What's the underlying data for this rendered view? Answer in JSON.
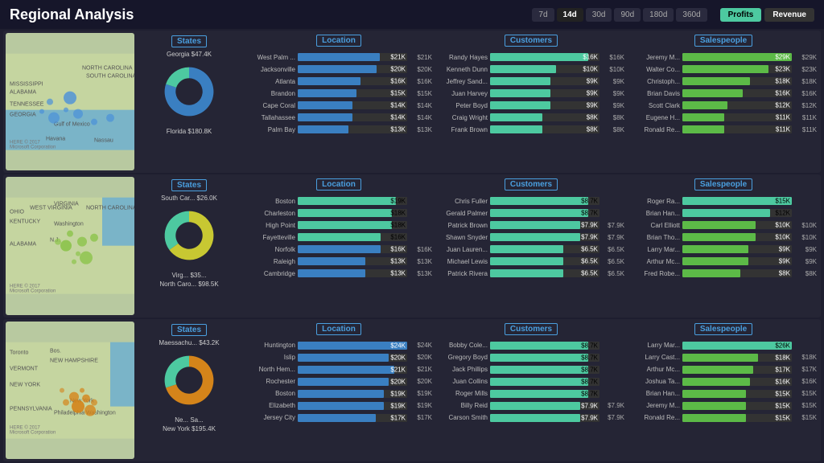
{
  "header": {
    "title": "Regional Analysis",
    "time_buttons": [
      "7d",
      "14d",
      "30d",
      "90d",
      "180d",
      "360d"
    ],
    "active_time": "14d",
    "toggle_profits": "Profits",
    "toggle_revenue": "Revenue"
  },
  "rows": [
    {
      "id": "row1",
      "map_region": "Southeast US",
      "states_header": "States",
      "states": [
        {
          "name": "Georgia",
          "value": "$47.4K"
        },
        {
          "name": "Florida",
          "value": "$180.8K"
        }
      ],
      "donut": {
        "segments": [
          {
            "color": "#3a7fc1",
            "pct": 80
          },
          {
            "color": "#4dc9a0",
            "pct": 20
          }
        ]
      },
      "location_header": "Location",
      "locations": [
        {
          "name": "West Palm ...",
          "value": "$21K",
          "pct": 75
        },
        {
          "name": "Jacksonville",
          "value": "$20K",
          "pct": 72
        },
        {
          "name": "Atlanta",
          "value": "$16K",
          "pct": 57
        },
        {
          "name": "Brandon",
          "value": "$15K",
          "pct": 54
        },
        {
          "name": "Cape Coral",
          "value": "$14K",
          "pct": 50
        },
        {
          "name": "Tallahassee",
          "value": "$14K",
          "pct": 50
        },
        {
          "name": "Palm Bay",
          "value": "$13K",
          "pct": 46
        }
      ],
      "customers_header": "Customers",
      "customers": [
        {
          "name": "Randy Hayes",
          "value": "$16K",
          "pct": 90
        },
        {
          "name": "Kenneth Dunn",
          "value": "$10K",
          "pct": 60
        },
        {
          "name": "Jeffrey Sand...",
          "value": "$9K",
          "pct": 55
        },
        {
          "name": "Juan Harvey",
          "value": "$9K",
          "pct": 55
        },
        {
          "name": "Peter Boyd",
          "value": "$9K",
          "pct": 55
        },
        {
          "name": "Craig Wright",
          "value": "$8K",
          "pct": 48
        },
        {
          "name": "Frank Brown",
          "value": "$8K",
          "pct": 48
        }
      ],
      "salespeople_header": "Salespeople",
      "salespeople": [
        {
          "name": "Jeremy M...",
          "value": "$29K",
          "pct": 100
        },
        {
          "name": "Walter Co...",
          "value": "$23K",
          "pct": 79
        },
        {
          "name": "Christoph...",
          "value": "$18K",
          "pct": 62
        },
        {
          "name": "Brian Davis",
          "value": "$16K",
          "pct": 55
        },
        {
          "name": "Scott Clark",
          "value": "$12K",
          "pct": 41
        },
        {
          "name": "Eugene H...",
          "value": "$11K",
          "pct": 38
        },
        {
          "name": "Ronald Re...",
          "value": "$11K",
          "pct": 38
        }
      ]
    },
    {
      "id": "row2",
      "map_region": "Mid-Atlantic US",
      "states_header": "States",
      "states": [
        {
          "name": "South Car...",
          "value": "$26.0K"
        },
        {
          "name": "Virg... $35...",
          "value": ""
        },
        {
          "name": "North Caro...",
          "value": "$98.5K"
        }
      ],
      "donut": {
        "segments": [
          {
            "color": "#c8c832",
            "pct": 65
          },
          {
            "color": "#4dc9a0",
            "pct": 35
          }
        ]
      },
      "location_header": "Location",
      "locations": [
        {
          "name": "Boston",
          "value": "$19K",
          "pct": 90,
          "highlight": true
        },
        {
          "name": "Charleston",
          "value": "$18K",
          "pct": 86,
          "highlight": true
        },
        {
          "name": "High Point",
          "value": "$18K",
          "pct": 86,
          "highlight": true
        },
        {
          "name": "Fayetteville",
          "value": "$16K",
          "pct": 76,
          "highlight": true
        },
        {
          "name": "Norfolk",
          "value": "$16K",
          "pct": 76
        },
        {
          "name": "Raleigh",
          "value": "$13K",
          "pct": 62
        },
        {
          "name": "Cambridge",
          "value": "$13K",
          "pct": 62
        }
      ],
      "customers_header": "Customers",
      "customers": [
        {
          "name": "Chris Fuller",
          "value": "$8.7K",
          "pct": 90,
          "highlight": true
        },
        {
          "name": "Gerald Palmer",
          "value": "$8.7K",
          "pct": 90,
          "highlight": true
        },
        {
          "name": "Patrick Brown",
          "value": "$7.9K",
          "pct": 82
        },
        {
          "name": "Shawn Snyder",
          "value": "$7.9K",
          "pct": 82
        },
        {
          "name": "Juan Lauren...",
          "value": "$6.5K",
          "pct": 67
        },
        {
          "name": "Michael Lewis",
          "value": "$6.5K",
          "pct": 67
        },
        {
          "name": "Patrick Rivera",
          "value": "$6.5K",
          "pct": 67
        }
      ],
      "salespeople_header": "Salespeople",
      "salespeople": [
        {
          "name": "Roger Ra...",
          "value": "$15K",
          "pct": 100,
          "highlight": true
        },
        {
          "name": "Brian Han...",
          "value": "$12K",
          "pct": 80,
          "highlight": true
        },
        {
          "name": "Carl Elliott",
          "value": "$10K",
          "pct": 67
        },
        {
          "name": "Brian Tho...",
          "value": "$10K",
          "pct": 67
        },
        {
          "name": "Larry Mar...",
          "value": "$9K",
          "pct": 60
        },
        {
          "name": "Arthur Mc...",
          "value": "$9K",
          "pct": 60
        },
        {
          "name": "Fred Robe...",
          "value": "$8K",
          "pct": 53
        }
      ]
    },
    {
      "id": "row3",
      "map_region": "Northeast US",
      "states_header": "States",
      "states": [
        {
          "name": "Maessachu...",
          "value": "$43.2K"
        },
        {
          "name": "Ne... Sa...",
          "value": ""
        },
        {
          "name": "New York",
          "value": "$195.4K"
        }
      ],
      "donut": {
        "segments": [
          {
            "color": "#d4841a",
            "pct": 70
          },
          {
            "color": "#4dc9a0",
            "pct": 30
          }
        ]
      },
      "location_header": "Location",
      "locations": [
        {
          "name": "Huntington",
          "value": "$24K",
          "pct": 100
        },
        {
          "name": "Islip",
          "value": "$20K",
          "pct": 83
        },
        {
          "name": "North Hem...",
          "value": "$21K",
          "pct": 88
        },
        {
          "name": "Rochester",
          "value": "$20K",
          "pct": 83
        },
        {
          "name": "Boston",
          "value": "$19K",
          "pct": 79
        },
        {
          "name": "Elizabeth",
          "value": "$19K",
          "pct": 79
        },
        {
          "name": "Jersey City",
          "value": "$17K",
          "pct": 71
        }
      ],
      "customers_header": "Customers",
      "customers": [
        {
          "name": "Bobby Cole...",
          "value": "$8.7K",
          "pct": 90,
          "highlight": true
        },
        {
          "name": "Gregory Boyd",
          "value": "$8.7K",
          "pct": 90,
          "highlight": true
        },
        {
          "name": "Jack Phillips",
          "value": "$8.7K",
          "pct": 90,
          "highlight": true
        },
        {
          "name": "Juan Collins",
          "value": "$8.7K",
          "pct": 90,
          "highlight": true
        },
        {
          "name": "Roger Mills",
          "value": "$8.7K",
          "pct": 90,
          "highlight": true
        },
        {
          "name": "Billy Reid",
          "value": "$7.9K",
          "pct": 82
        },
        {
          "name": "Carson Smith",
          "value": "$7.9K",
          "pct": 82
        }
      ],
      "salespeople_header": "Salespeople",
      "salespeople": [
        {
          "name": "Larry Mar...",
          "value": "$26K",
          "pct": 100,
          "highlight": true
        },
        {
          "name": "Larry Cast...",
          "value": "$18K",
          "pct": 69
        },
        {
          "name": "Arthur Mc...",
          "value": "$17K",
          "pct": 65
        },
        {
          "name": "Joshua Ta...",
          "value": "$16K",
          "pct": 62
        },
        {
          "name": "Brian Han...",
          "value": "$15K",
          "pct": 58
        },
        {
          "name": "Jeremy M...",
          "value": "$15K",
          "pct": 58
        },
        {
          "name": "Ronald Re...",
          "value": "$15K",
          "pct": 58
        }
      ]
    }
  ]
}
